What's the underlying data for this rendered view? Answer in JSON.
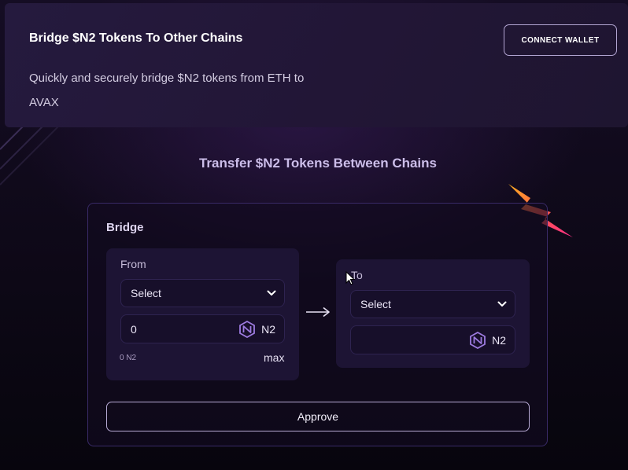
{
  "header": {
    "title": "Bridge $N2 Tokens To Other Chains",
    "description": "Quickly and securely bridge $N2 tokens from ETH to AVAX",
    "connect_wallet_label": "CONNECT WALLET"
  },
  "section_title": "Transfer $N2 Tokens Between Chains",
  "bridge": {
    "title": "Bridge",
    "from": {
      "label": "From",
      "select_value": "Select",
      "amount": "0",
      "token": "N2",
      "balance": "0 N2",
      "max_label": "max"
    },
    "to": {
      "label": "To",
      "select_value": "Select",
      "amount": "",
      "token": "N2"
    },
    "approve_label": "Approve"
  },
  "icons": {
    "connect": "wallet-button",
    "chevron": "chevron-down-icon",
    "token_logo": "n2-token-logo-icon",
    "arrow": "arrow-right-icon",
    "decoration": "lightning-icon",
    "cursor": "mouse-pointer-icon"
  },
  "colors": {
    "background": "#0d0816",
    "card": "#221636",
    "panel": "#1d1434",
    "accent": "#cbbde9",
    "token_logo": "#9d7be0",
    "lightning": "#ff4d7a"
  }
}
